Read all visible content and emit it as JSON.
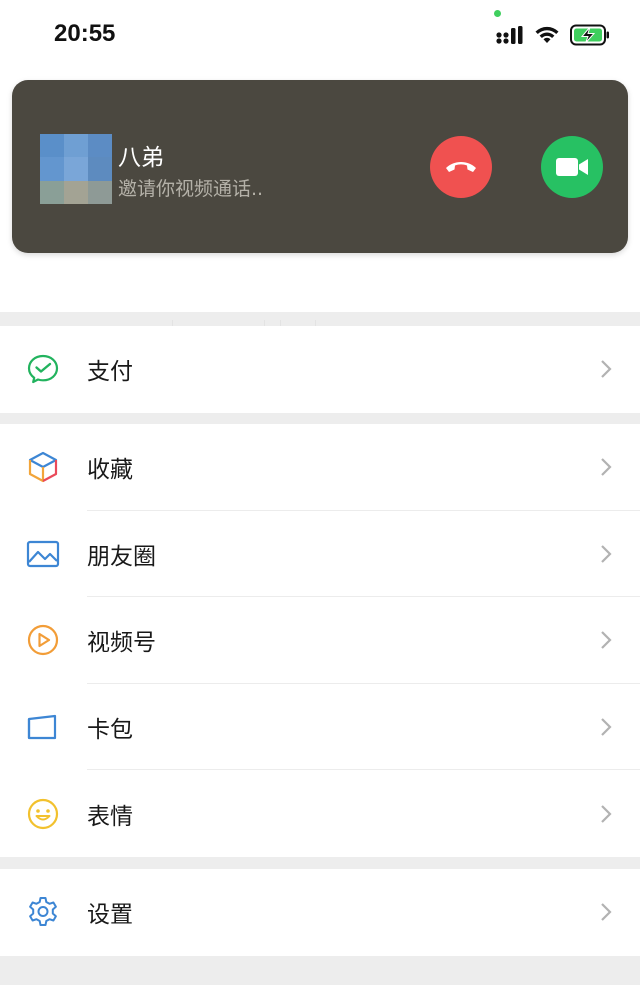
{
  "status_bar": {
    "time": "20:55"
  },
  "incoming_call": {
    "caller_name": "八弟",
    "subtitle": "邀请你视频通话..",
    "decline_icon": "phone-hangup-icon",
    "accept_icon": "video-camera-icon",
    "decline_color": "#f05150",
    "accept_color": "#27c163"
  },
  "menu": {
    "pay": {
      "label": "支付",
      "icon": "pay-icon"
    },
    "favorites": {
      "label": "收藏",
      "icon": "cube-icon"
    },
    "moments": {
      "label": "朋友圈",
      "icon": "picture-icon"
    },
    "channels": {
      "label": "视频号",
      "icon": "play-circle-icon"
    },
    "cards": {
      "label": "卡包",
      "icon": "card-icon"
    },
    "stickers": {
      "label": "表情",
      "icon": "smiley-icon"
    },
    "settings": {
      "label": "设置",
      "icon": "gear-icon"
    }
  }
}
